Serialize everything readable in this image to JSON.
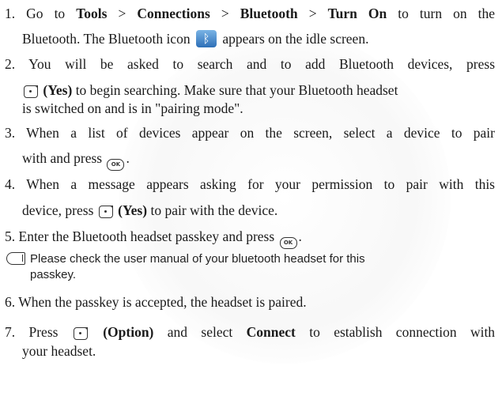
{
  "steps": [
    {
      "num": "1.",
      "a": "Go to",
      "tools": "Tools",
      "gt1": ">",
      "connections": "Connections",
      "gt2": ">",
      "bluetooth": "Bluetooth",
      "gt3": ">",
      "turn_on": "Turn On",
      "b": "to turn on the",
      "line2_a": "Bluetooth. The Bluetooth icon",
      "line2_b": "appears on the idle screen."
    },
    {
      "num": "2.",
      "line1": "You will be asked to search and to add Bluetooth devices, press",
      "yes": "(Yes)",
      "line2": "to begin searching. Make sure that your Bluetooth headset",
      "line3": "is switched on and is in \"pairing mode\"."
    },
    {
      "num": "3.",
      "line1": "When a list of devices appear on the screen, select a device to pair",
      "line2": "with and press",
      "end": "."
    },
    {
      "num": "4.",
      "line1": "When a message appears asking for your permission to pair with this",
      "line2_a": "device, press",
      "yes": "(Yes)",
      "line2_b": "to pair with the device."
    },
    {
      "num": "5.",
      "text": "Enter the Bluetooth headset passkey and press",
      "end": "."
    },
    {
      "num": "6.",
      "text": "When the passkey is accepted, the headset is paired."
    },
    {
      "num": "7.",
      "press": "Press",
      "option": "(Option)",
      "and_select": "and select",
      "connect": "Connect",
      "rest": "to establish connection with",
      "line2": "your headset."
    }
  ],
  "note": {
    "line1": "Please check the user manual of your bluetooth headset for this",
    "line2": "passkey."
  },
  "icons": {
    "ok_key_label": "OK"
  }
}
